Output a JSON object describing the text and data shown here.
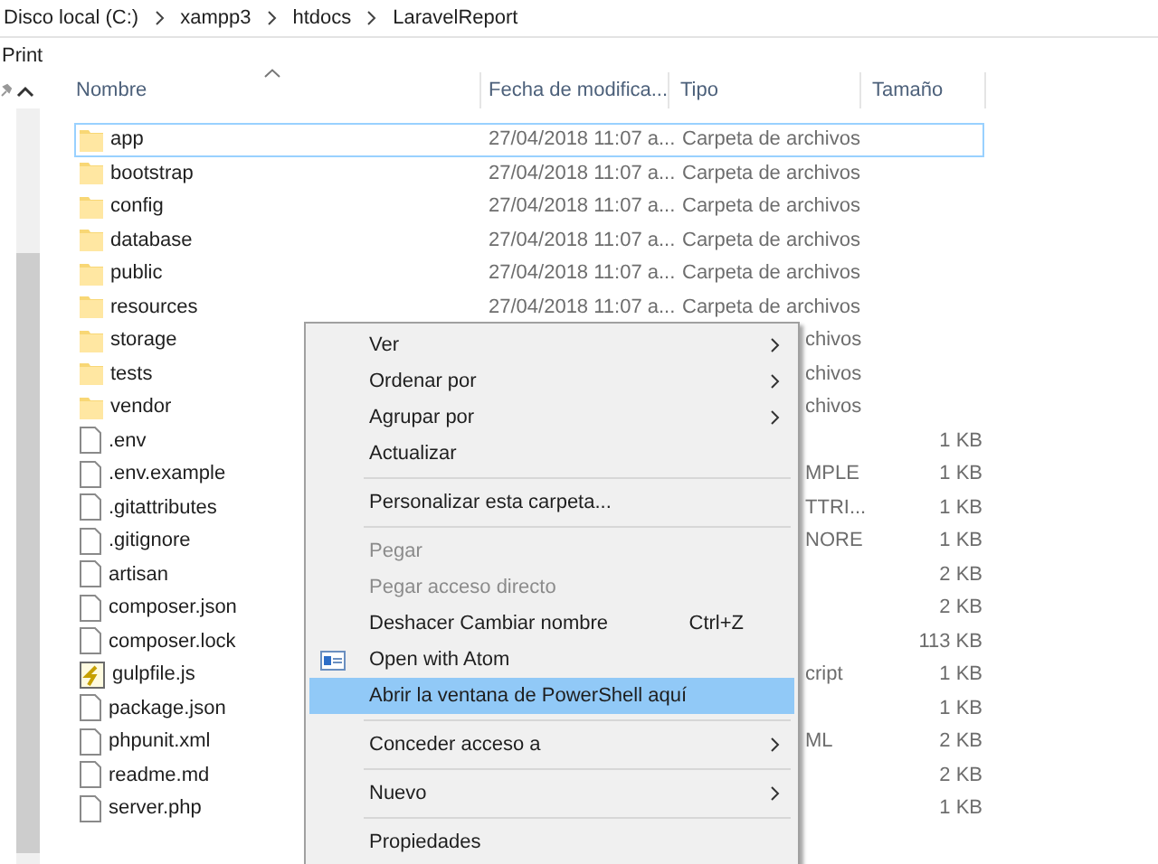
{
  "breadcrumb": [
    "Disco local (C:)",
    "xampp3",
    "htdocs",
    "LaravelReport"
  ],
  "ribbon_tab": "Print",
  "columns": [
    "Nombre",
    "Fecha de modifica...",
    "Tipo",
    "Tamaño"
  ],
  "rows": [
    {
      "name": "app",
      "kind": "folder",
      "date": "27/04/2018 11:07 a...",
      "type": "Carpeta de archivos",
      "selected": true
    },
    {
      "name": "bootstrap",
      "kind": "folder",
      "date": "27/04/2018 11:07 a...",
      "type": "Carpeta de archivos",
      "selected": false
    },
    {
      "name": "config",
      "kind": "folder",
      "date": "27/04/2018 11:07 a...",
      "type": "Carpeta de archivos",
      "selected": false
    },
    {
      "name": "database",
      "kind": "folder",
      "date": "27/04/2018 11:07 a...",
      "type": "Carpeta de archivos",
      "selected": false
    },
    {
      "name": "public",
      "kind": "folder",
      "date": "27/04/2018 11:07 a...",
      "type": "Carpeta de archivos",
      "selected": false
    },
    {
      "name": "resources",
      "kind": "folder",
      "date": "27/04/2018 11:07 a...",
      "type": "Carpeta de archivos",
      "selected": false
    },
    {
      "name": "storage",
      "kind": "folder",
      "type": "chivos",
      "type_cut": true,
      "selected": false
    },
    {
      "name": "tests",
      "kind": "folder",
      "type": "chivos",
      "type_cut": true,
      "selected": false
    },
    {
      "name": "vendor",
      "kind": "folder",
      "type": "chivos",
      "type_cut": true,
      "selected": false
    },
    {
      "name": ".env",
      "kind": "file",
      "size": "1 KB",
      "selected": false
    },
    {
      "name": ".env.example",
      "kind": "file",
      "type": "MPLE",
      "type_cut": true,
      "size": "1 KB",
      "selected": false
    },
    {
      "name": ".gitattributes",
      "kind": "file",
      "type": "TTRI...",
      "type_cut": true,
      "size": "1 KB",
      "selected": false
    },
    {
      "name": ".gitignore",
      "kind": "file",
      "type": "NORE",
      "type_cut": true,
      "size": "1 KB",
      "selected": false
    },
    {
      "name": "artisan",
      "kind": "file",
      "size": "2 KB",
      "selected": false
    },
    {
      "name": "composer.json",
      "kind": "file",
      "size": "2 KB",
      "selected": false
    },
    {
      "name": "composer.lock",
      "kind": "file",
      "size": "113 KB",
      "selected": false
    },
    {
      "name": "gulpfile.js",
      "kind": "script",
      "type": "cript",
      "type_cut": true,
      "size": "1 KB",
      "selected": false
    },
    {
      "name": "package.json",
      "kind": "file",
      "size": "1 KB",
      "selected": false
    },
    {
      "name": "phpunit.xml",
      "kind": "file",
      "type": "ML",
      "type_cut": true,
      "size": "2 KB",
      "selected": false
    },
    {
      "name": "readme.md",
      "kind": "file",
      "size": "2 KB",
      "selected": false
    },
    {
      "name": "server.php",
      "kind": "file",
      "size": "1 KB",
      "selected": false
    }
  ],
  "context_menu": [
    {
      "kind": "item",
      "label": "Ver",
      "submenu": true,
      "disabled": false,
      "selected": false
    },
    {
      "kind": "item",
      "label": "Ordenar por",
      "submenu": true,
      "disabled": false,
      "selected": false
    },
    {
      "kind": "item",
      "label": "Agrupar por",
      "submenu": true,
      "disabled": false,
      "selected": false
    },
    {
      "kind": "item",
      "label": "Actualizar",
      "submenu": false,
      "disabled": false,
      "selected": false
    },
    {
      "kind": "separator"
    },
    {
      "kind": "item",
      "label": "Personalizar esta carpeta...",
      "submenu": false,
      "disabled": false,
      "selected": false
    },
    {
      "kind": "separator"
    },
    {
      "kind": "item",
      "label": "Pegar",
      "submenu": false,
      "disabled": true,
      "selected": false
    },
    {
      "kind": "item",
      "label": "Pegar acceso directo",
      "submenu": false,
      "disabled": true,
      "selected": false
    },
    {
      "kind": "item",
      "label": "Deshacer Cambiar nombre",
      "shortcut": "Ctrl+Z",
      "submenu": false,
      "disabled": false,
      "selected": false
    },
    {
      "kind": "icon_item",
      "label": "Open with Atom",
      "submenu": false,
      "disabled": false,
      "selected": false
    },
    {
      "kind": "item",
      "label": "Abrir la ventana de PowerShell aquí",
      "submenu": false,
      "disabled": false,
      "selected": true
    },
    {
      "kind": "separator"
    },
    {
      "kind": "item",
      "label": "Conceder acceso a",
      "submenu": true,
      "disabled": false,
      "selected": false
    },
    {
      "kind": "separator"
    },
    {
      "kind": "item",
      "label": "Nuevo",
      "submenu": true,
      "disabled": false,
      "selected": false
    },
    {
      "kind": "separator"
    },
    {
      "kind": "item",
      "label": "Propiedades",
      "submenu": false,
      "disabled": false,
      "selected": false
    }
  ]
}
